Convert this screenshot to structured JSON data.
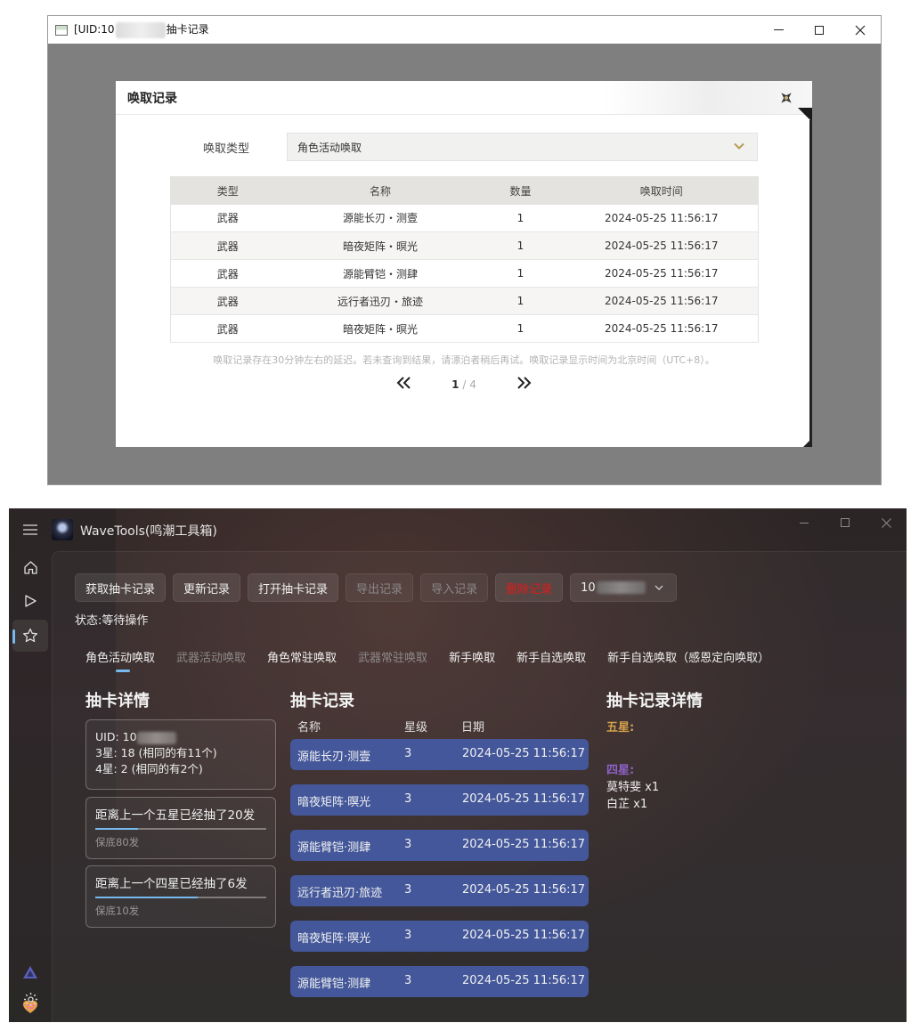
{
  "top_window": {
    "title_prefix": "[UID:10",
    "title_suffix": "抽卡记录",
    "dialog": {
      "title": "唤取记录",
      "type_label": "唤取类型",
      "type_value": "角色活动唤取",
      "columns": [
        "类型",
        "名称",
        "数量",
        "唤取时间"
      ],
      "rows": [
        [
          "武器",
          "源能长刃・测壹",
          "1",
          "2024-05-25 11:56:17"
        ],
        [
          "武器",
          "暗夜矩阵・暝光",
          "1",
          "2024-05-25 11:56:17"
        ],
        [
          "武器",
          "源能臂铠・测肆",
          "1",
          "2024-05-25 11:56:17"
        ],
        [
          "武器",
          "远行者迅刃・旅迹",
          "1",
          "2024-05-25 11:56:17"
        ],
        [
          "武器",
          "暗夜矩阵・暝光",
          "1",
          "2024-05-25 11:56:17"
        ]
      ],
      "note": "唤取记录存在30分钟左右的延迟。若未查询到结果，请漂泊者稍后再试。唤取记录显示时间为北京时间（UTC+8）。",
      "pager": {
        "prev": "«",
        "current": "1",
        "separator": "/",
        "total": "4",
        "next": "»"
      }
    }
  },
  "app": {
    "title": "WaveTools(鸣潮工具箱)",
    "toolbar": {
      "get_records": "获取抽卡记录",
      "update_records": "更新记录",
      "open_records": "打开抽卡记录",
      "export_records": "导出记录",
      "import_records": "导入记录",
      "delete_records": "删除记录",
      "uid_prefix": "10"
    },
    "status": "状态:等待操作",
    "tabs": [
      "角色活动唤取",
      "武器活动唤取",
      "角色常驻唤取",
      "武器常驻唤取",
      "新手唤取",
      "新手自选唤取",
      "新手自选唤取（感恩定向唤取）"
    ],
    "details": {
      "heading": "抽卡详情",
      "uid_label": "UID: 10",
      "three_star": "3星: 18 (相同的有11个)",
      "four_star": "4星: 2 (相同的有2个)",
      "five_star_card": {
        "text": "距离上一个五星已经抽了20发",
        "progress": 0.25,
        "sub": "保底80发"
      },
      "four_star_card": {
        "text": "距离上一个四星已经抽了6发",
        "progress": 0.6,
        "sub": "保底10发"
      }
    },
    "records": {
      "heading": "抽卡记录",
      "columns": [
        "名称",
        "星级",
        "日期"
      ],
      "rows": [
        [
          "源能长刃·测壹",
          "3",
          "2024-05-25 11:56:17"
        ],
        [
          "暗夜矩阵·暝光",
          "3",
          "2024-05-25 11:56:17"
        ],
        [
          "源能臂铠·测肆",
          "3",
          "2024-05-25 11:56:17"
        ],
        [
          "远行者迅刃·旅迹",
          "3",
          "2024-05-25 11:56:17"
        ],
        [
          "暗夜矩阵·暝光",
          "3",
          "2024-05-25 11:56:17"
        ],
        [
          "源能臂铠·测肆",
          "3",
          "2024-05-25 11:56:17"
        ]
      ]
    },
    "record_details": {
      "heading": "抽卡记录详情",
      "five_star_label": "五星:",
      "four_star_label": "四星:",
      "four_star_items": [
        "莫特斐 x1",
        "白芷 x1"
      ]
    },
    "colors": {
      "accent": "#76b9ed",
      "row_bg": "#43579a",
      "five_star": "#d4a04a",
      "four_star": "#8d61c7",
      "danger": "#e01b1b"
    }
  }
}
